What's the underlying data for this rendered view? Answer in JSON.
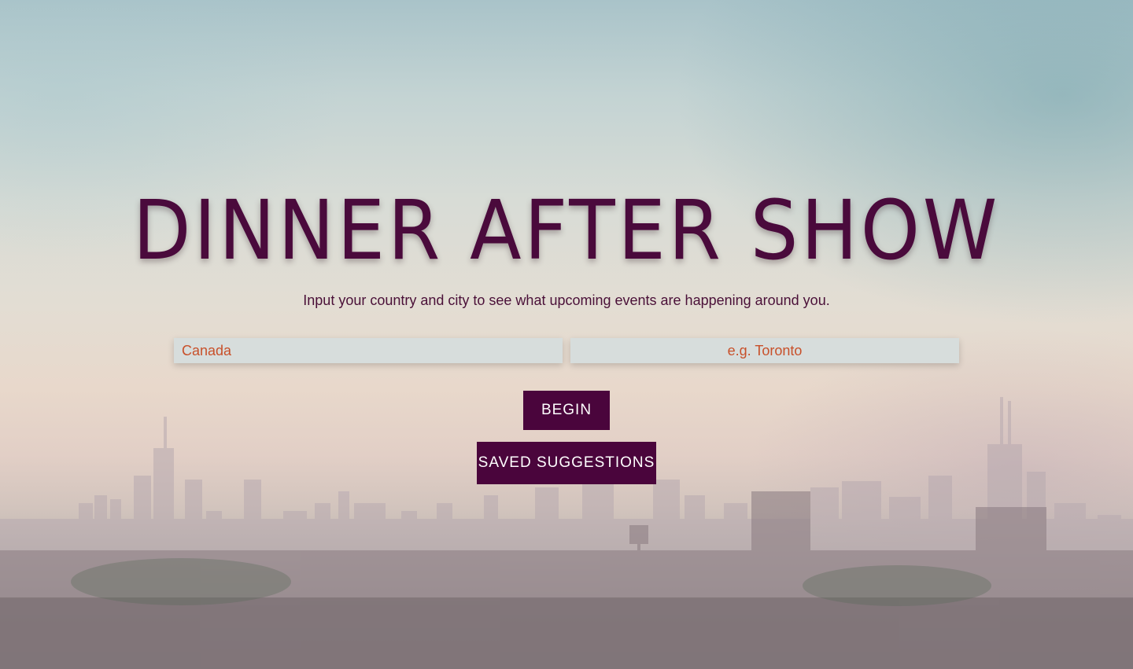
{
  "page": {
    "title": "DINNER AFTER SHOW",
    "subtitle": "Input your country and city to see what upcoming events are happening around you."
  },
  "form": {
    "country_value": "Canada",
    "country_placeholder": "",
    "city_value": "",
    "city_placeholder": "e.g. Toronto",
    "begin_label": "BEGIN",
    "saved_label": "SAVED SUGGESTIONS"
  },
  "background": {
    "icon": "city-skyline-photo"
  },
  "colors": {
    "brand": "#4a053c",
    "input_text": "#c8502a",
    "input_bg": "#d6dddc"
  }
}
